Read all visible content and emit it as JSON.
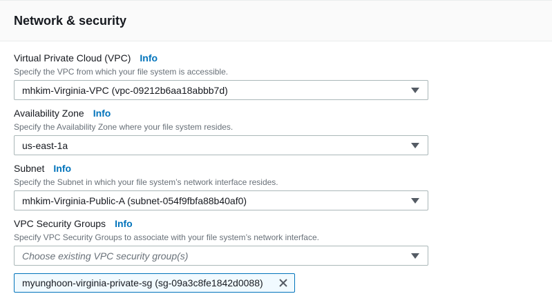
{
  "section": {
    "title": "Network & security"
  },
  "vpc": {
    "label": "Virtual Private Cloud (VPC)",
    "info": "Info",
    "description": "Specify the VPC from which your file system is accessible.",
    "value": "mhkim-Virginia-VPC (vpc-09212b6aa18abbb7d)"
  },
  "az": {
    "label": "Availability Zone",
    "info": "Info",
    "description": "Specify the Availability Zone where your file system resides.",
    "value": "us-east-1a"
  },
  "subnet": {
    "label": "Subnet",
    "info": "Info",
    "description": "Specify the Subnet in which your file system’s network interface resides.",
    "value": "mhkim-Virginia-Public-A (subnet-054f9fbfa88b40af0)"
  },
  "security_groups": {
    "label": "VPC Security Groups",
    "info": "Info",
    "description": "Specify VPC Security Groups to associate with your file system’s network interface.",
    "placeholder": "Choose existing VPC security group(s)",
    "selected": [
      "myunghoon-virginia-private-sg (sg-09a3c8fe1842d0088)"
    ]
  },
  "colors": {
    "link": "#0073bb",
    "token_border": "#0073bb",
    "token_bg": "#f1faff"
  },
  "icons": {
    "caret": "caret-down-icon",
    "remove": "close-icon"
  }
}
